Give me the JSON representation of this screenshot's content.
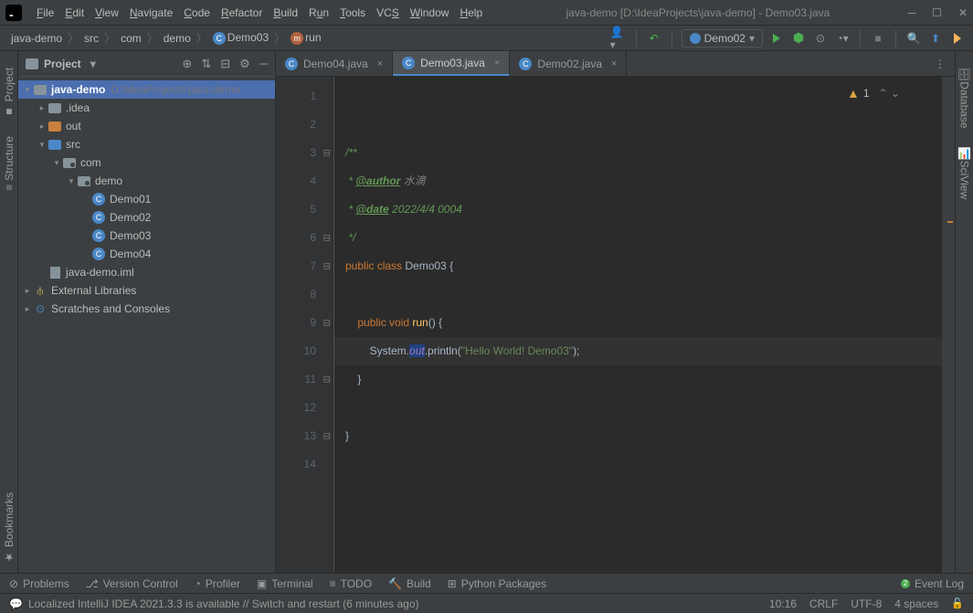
{
  "titlebar": {
    "path": "java-demo [D:\\IdeaProjects\\java-demo] - Demo03.java",
    "menus": [
      "File",
      "Edit",
      "View",
      "Navigate",
      "Code",
      "Refactor",
      "Build",
      "Run",
      "Tools",
      "VCS",
      "Window",
      "Help"
    ]
  },
  "breadcrumbs": {
    "items": [
      "java-demo",
      "src",
      "com",
      "demo",
      "Demo03",
      "run"
    ],
    "runConfig": "Demo02"
  },
  "projectPanel": {
    "title": "Project",
    "root": {
      "name": "java-demo",
      "path": "D:\\IdeaProjects\\java-demo"
    },
    "idea": ".idea",
    "out": "out",
    "src": "src",
    "com": "com",
    "demo": "demo",
    "classes": [
      "Demo01",
      "Demo02",
      "Demo03",
      "Demo04"
    ],
    "iml": "java-demo.iml",
    "extLib": "External Libraries",
    "scratches": "Scratches and Consoles"
  },
  "tabs": {
    "t0": "Demo04.java",
    "t1": "Demo03.java",
    "t2": "Demo02.java"
  },
  "code": {
    "lines": [
      "1",
      "2",
      "3",
      "4",
      "5",
      "6",
      "7",
      "8",
      "9",
      "10",
      "11",
      "12",
      "13",
      "14"
    ],
    "l3": "/**",
    "l4_tag": "@author",
    "l4_txt": " 水滴",
    "l5_tag": "@date",
    "l5_txt": " 2022/4/4 0004",
    "l6": " */",
    "l7_k1": "public class ",
    "l7_cls": "Demo03 ",
    "l7_b": "{",
    "l9_k": "public void ",
    "l9_m": "run",
    "l9_b": "() {",
    "l10_sys": "System.",
    "l10_out": "out",
    "l10_p": ".println(",
    "l10_str": "\"Hello World! Demo03\"",
    "l10_e": ");",
    "l11": "}",
    "l13": "}",
    "warnCount": "1"
  },
  "leftTabs": {
    "project": "Project",
    "structure": "Structure",
    "bookmarks": "Bookmarks"
  },
  "rightTabs": {
    "database": "Database",
    "sciview": "SciView"
  },
  "bottom": {
    "problems": "Problems",
    "vcs": "Version Control",
    "profiler": "Profiler",
    "terminal": "Terminal",
    "todo": "TODO",
    "build": "Build",
    "python": "Python Packages",
    "event": "Event Log"
  },
  "status": {
    "msg": "Localized IntelliJ IDEA 2021.3.3 is available // Switch and restart (6 minutes ago)",
    "pos": "10:16",
    "eol": "CRLF",
    "enc": "UTF-8",
    "indent": "4 spaces"
  }
}
